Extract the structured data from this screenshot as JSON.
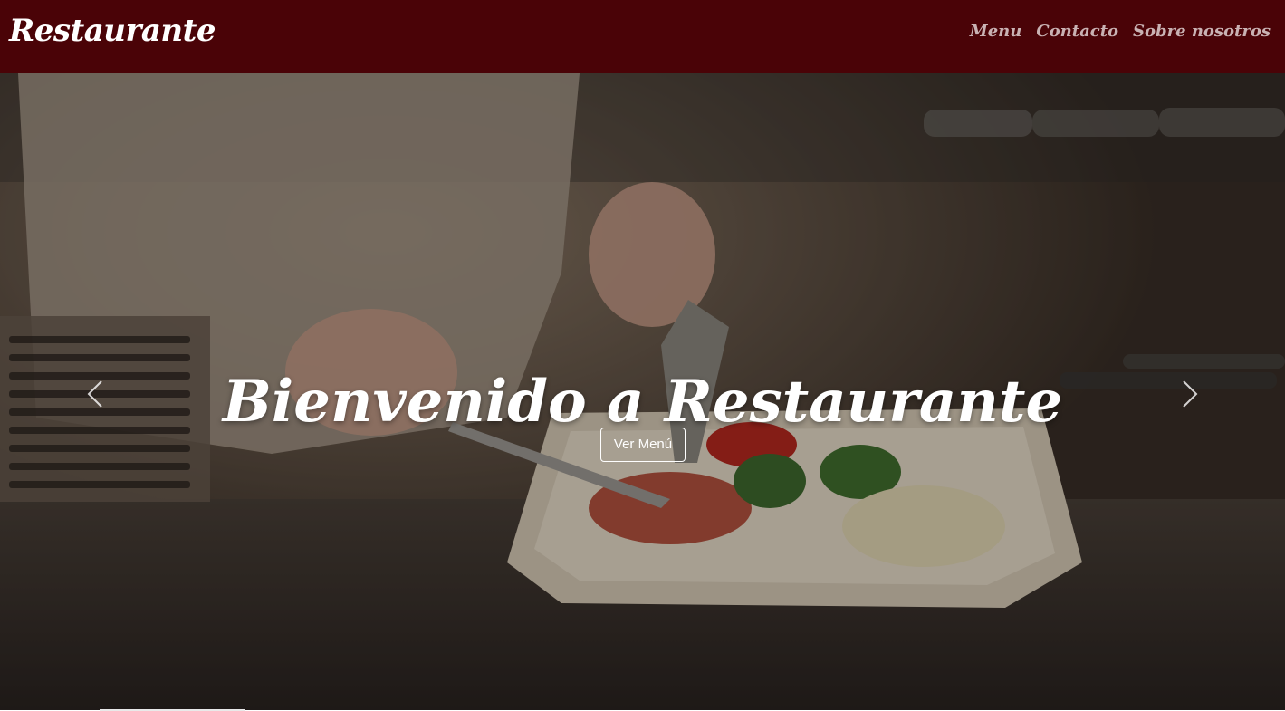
{
  "navbar": {
    "brand": "Restaurante",
    "links": [
      {
        "label": "Menu"
      },
      {
        "label": "Contacto"
      },
      {
        "label": "Sobre nosotros"
      }
    ]
  },
  "hero": {
    "title": "Bienvenido a Restaurante",
    "cta_label": "Ver Menú",
    "prev_icon": "chevron-left-icon",
    "next_icon": "chevron-right-icon"
  },
  "colors": {
    "navbar_bg": "#4a0307",
    "nav_link": "#c9b2b3",
    "text": "#ffffff"
  }
}
